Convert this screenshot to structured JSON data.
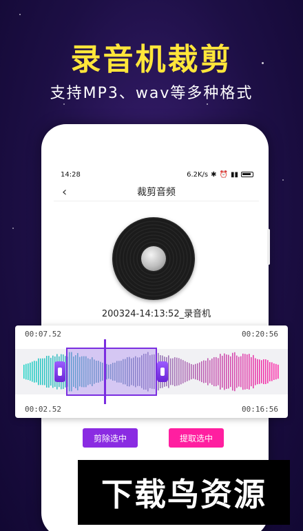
{
  "promo": {
    "headline": "录音机裁剪",
    "subline": "支持MP3、wav等多种格式"
  },
  "status_bar": {
    "time": "14:28",
    "net_speed": "6.2K/s"
  },
  "screen": {
    "title": "裁剪音频",
    "file_name": "200324-14:13:52_录音机"
  },
  "editor": {
    "selection_start_top": "00:07.52",
    "total_end_top": "00:20:56",
    "selection_start_bottom": "00:02.52",
    "selection_end_bottom": "00:16:56"
  },
  "actions": {
    "cut_label": "剪除选中",
    "extract_label": "提取选中"
  },
  "watermark": {
    "text": "下载鸟资源"
  },
  "colors": {
    "headline": "#ffe63a",
    "selection": "#7a2de0",
    "cut_button": "#8a2be2",
    "extract_button": "#ff1fa0",
    "wave_left": "#1fd3c6",
    "wave_right": "#ff2aa8"
  }
}
